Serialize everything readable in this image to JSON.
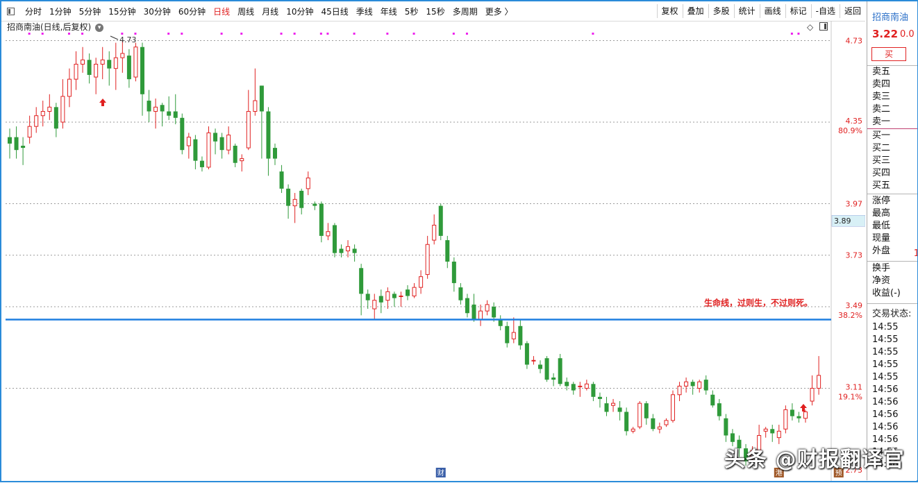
{
  "toolbar": {
    "periods": [
      {
        "label": "分时",
        "active": false
      },
      {
        "label": "1分钟",
        "active": false
      },
      {
        "label": "5分钟",
        "active": false
      },
      {
        "label": "15分钟",
        "active": false
      },
      {
        "label": "30分钟",
        "active": false
      },
      {
        "label": "60分钟",
        "active": false
      },
      {
        "label": "日线",
        "active": true
      },
      {
        "label": "周线",
        "active": false
      },
      {
        "label": "月线",
        "active": false
      },
      {
        "label": "10分钟",
        "active": false
      },
      {
        "label": "45日线",
        "active": false
      },
      {
        "label": "季线",
        "active": false
      },
      {
        "label": "年线",
        "active": false
      },
      {
        "label": "5秒",
        "active": false
      },
      {
        "label": "15秒",
        "active": false
      },
      {
        "label": "多周期",
        "active": false
      },
      {
        "label": "更多 〉",
        "active": false
      }
    ],
    "tools": [
      "复权",
      "叠加",
      "多股",
      "统计",
      "画线",
      "标记",
      "-自选",
      "返回"
    ]
  },
  "chart": {
    "title": "招商南油(日线,后复权)",
    "high_label": "4.73",
    "annotation": "生命线，过则生，不过则死。",
    "price_tag": "3.89",
    "axis_labels": [
      {
        "price": 4.73,
        "text": "4.73",
        "pct": ""
      },
      {
        "price": 4.35,
        "text": "4.35",
        "pct": "80.9%"
      },
      {
        "price": 3.97,
        "text": "3.97",
        "pct": ""
      },
      {
        "price": 3.73,
        "text": "3.73",
        "pct": ""
      },
      {
        "price": 3.49,
        "text": "3.49",
        "pct": "38.2%"
      },
      {
        "price": 3.11,
        "text": "3.11",
        "pct": "19.1%"
      },
      {
        "price": 2.73,
        "text": "2.73",
        "pct": ""
      }
    ],
    "lifeline_price": 3.43,
    "colors": {
      "up": "#e02020",
      "down": "#2f9a3a",
      "lifeline": "#1f7fe0",
      "marker": "#ee22ee",
      "grid": "#9a9a9a"
    },
    "bottom_markers": [
      {
        "label": "财",
        "index": 65
      },
      {
        "label": "港",
        "index": 116
      },
      {
        "label": "预",
        "index": 125
      }
    ]
  },
  "chart_data": {
    "type": "candlestick",
    "ylim": [
      2.73,
      4.78
    ],
    "ohlc": [
      [
        4.28,
        4.25,
        4.18,
        4.32
      ],
      [
        4.28,
        4.22,
        4.18,
        4.33
      ],
      [
        4.24,
        4.23,
        4.15,
        4.28
      ],
      [
        4.28,
        4.33,
        4.25,
        4.38
      ],
      [
        4.33,
        4.38,
        4.3,
        4.42
      ],
      [
        4.38,
        4.4,
        4.33,
        4.45
      ],
      [
        4.4,
        4.42,
        4.36,
        4.48
      ],
      [
        4.42,
        4.32,
        4.28,
        4.44
      ],
      [
        4.35,
        4.47,
        4.32,
        4.55
      ],
      [
        4.47,
        4.55,
        4.42,
        4.6
      ],
      [
        4.55,
        4.62,
        4.5,
        4.68
      ],
      [
        4.62,
        4.64,
        4.58,
        4.7
      ],
      [
        4.64,
        4.57,
        4.53,
        4.67
      ],
      [
        4.56,
        4.62,
        4.48,
        4.65
      ],
      [
        4.62,
        4.64,
        4.55,
        4.7
      ],
      [
        4.64,
        4.6,
        4.52,
        4.68
      ],
      [
        4.6,
        4.65,
        4.5,
        4.72
      ],
      [
        4.65,
        4.67,
        4.58,
        4.73
      ],
      [
        4.66,
        4.55,
        4.51,
        4.69
      ],
      [
        4.56,
        4.7,
        4.54,
        4.72
      ],
      [
        4.7,
        4.48,
        4.38,
        4.72
      ],
      [
        4.45,
        4.4,
        4.35,
        4.5
      ],
      [
        4.4,
        4.42,
        4.32,
        4.46
      ],
      [
        4.43,
        4.4,
        4.33,
        4.44
      ],
      [
        4.4,
        4.38,
        4.36,
        4.47
      ],
      [
        4.4,
        4.37,
        4.34,
        4.48
      ],
      [
        4.37,
        4.22,
        4.2,
        4.39
      ],
      [
        4.24,
        4.28,
        4.18,
        4.3
      ],
      [
        4.27,
        4.17,
        4.13,
        4.29
      ],
      [
        4.17,
        4.14,
        4.12,
        4.19
      ],
      [
        4.14,
        4.3,
        4.13,
        4.33
      ],
      [
        4.3,
        4.26,
        4.2,
        4.32
      ],
      [
        4.28,
        4.22,
        4.18,
        4.3
      ],
      [
        4.22,
        4.29,
        4.2,
        4.33
      ],
      [
        4.24,
        4.16,
        4.14,
        4.25
      ],
      [
        4.17,
        4.18,
        4.12,
        4.2
      ],
      [
        4.23,
        4.4,
        4.22,
        4.5
      ],
      [
        4.4,
        4.45,
        4.38,
        4.6
      ],
      [
        4.52,
        4.4,
        4.18,
        4.52
      ],
      [
        4.4,
        4.18,
        4.1,
        4.42
      ],
      [
        4.23,
        4.18,
        4.15,
        4.25
      ],
      [
        4.12,
        4.04,
        4.02,
        4.15
      ],
      [
        4.04,
        3.96,
        3.9,
        4.06
      ],
      [
        3.96,
        3.99,
        3.88,
        4.02
      ],
      [
        4.03,
        3.95,
        3.92,
        4.04
      ],
      [
        4.04,
        4.09,
        4.01,
        4.12
      ],
      [
        3.97,
        3.96,
        3.94,
        3.98
      ],
      [
        3.97,
        3.82,
        3.79,
        3.98
      ],
      [
        3.82,
        3.84,
        3.8,
        3.88
      ],
      [
        3.87,
        3.74,
        3.72,
        3.88
      ],
      [
        3.76,
        3.74,
        3.72,
        3.78
      ],
      [
        3.75,
        3.77,
        3.72,
        3.8
      ],
      [
        3.76,
        3.74,
        3.7,
        3.78
      ],
      [
        3.67,
        3.55,
        3.45,
        3.69
      ],
      [
        3.55,
        3.52,
        3.48,
        3.57
      ],
      [
        3.48,
        3.52,
        3.43,
        3.55
      ],
      [
        3.54,
        3.51,
        3.46,
        3.57
      ],
      [
        3.52,
        3.56,
        3.48,
        3.58
      ],
      [
        3.55,
        3.53,
        3.49,
        3.56
      ],
      [
        3.54,
        3.54,
        3.49,
        3.56
      ],
      [
        3.57,
        3.54,
        3.52,
        3.59
      ],
      [
        3.54,
        3.58,
        3.53,
        3.6
      ],
      [
        3.58,
        3.63,
        3.55,
        3.66
      ],
      [
        3.64,
        3.78,
        3.62,
        3.82
      ],
      [
        3.8,
        3.87,
        3.78,
        3.92
      ],
      [
        3.96,
        3.82,
        3.8,
        3.97
      ],
      [
        3.8,
        3.7,
        3.67,
        3.82
      ],
      [
        3.7,
        3.6,
        3.56,
        3.72
      ],
      [
        3.58,
        3.52,
        3.5,
        3.6
      ],
      [
        3.53,
        3.46,
        3.44,
        3.55
      ],
      [
        3.5,
        3.43,
        3.42,
        3.55
      ],
      [
        3.43,
        3.47,
        3.4,
        3.5
      ],
      [
        3.47,
        3.5,
        3.45,
        3.52
      ],
      [
        3.49,
        3.44,
        3.42,
        3.51
      ],
      [
        3.43,
        3.4,
        3.38,
        3.45
      ],
      [
        3.4,
        3.32,
        3.3,
        3.42
      ],
      [
        3.34,
        3.37,
        3.32,
        3.44
      ],
      [
        3.4,
        3.31,
        3.29,
        3.43
      ],
      [
        3.32,
        3.22,
        3.2,
        3.33
      ],
      [
        3.24,
        3.24,
        3.22,
        3.26
      ],
      [
        3.22,
        3.2,
        3.18,
        3.24
      ],
      [
        3.25,
        3.15,
        3.14,
        3.26
      ],
      [
        3.16,
        3.15,
        3.12,
        3.18
      ],
      [
        3.25,
        3.13,
        3.12,
        3.27
      ],
      [
        3.14,
        3.12,
        3.1,
        3.16
      ],
      [
        3.13,
        3.1,
        3.08,
        3.14
      ],
      [
        3.12,
        3.12,
        3.07,
        3.14
      ],
      [
        3.11,
        3.13,
        3.1,
        3.15
      ],
      [
        3.13,
        3.07,
        3.05,
        3.14
      ],
      [
        3.07,
        3.06,
        3.02,
        3.09
      ],
      [
        3.04,
        3.0,
        2.98,
        3.07
      ],
      [
        3.03,
        3.04,
        3.0,
        3.06
      ],
      [
        3.02,
        3.0,
        2.96,
        3.05
      ],
      [
        3.0,
        2.91,
        2.89,
        3.02
      ],
      [
        2.91,
        2.92,
        2.9,
        2.93
      ],
      [
        2.93,
        3.04,
        2.92,
        3.05
      ],
      [
        3.04,
        2.97,
        2.94,
        3.05
      ],
      [
        2.97,
        2.92,
        2.91,
        2.99
      ],
      [
        2.92,
        2.93,
        2.9,
        2.95
      ],
      [
        2.94,
        2.96,
        2.93,
        2.97
      ],
      [
        2.96,
        3.08,
        2.95,
        3.1
      ],
      [
        3.08,
        3.12,
        3.05,
        3.14
      ],
      [
        3.12,
        3.14,
        3.09,
        3.16
      ],
      [
        3.14,
        3.12,
        3.08,
        3.15
      ],
      [
        3.11,
        3.14,
        3.09,
        3.15
      ],
      [
        3.15,
        3.1,
        3.08,
        3.17
      ],
      [
        3.08,
        3.03,
        3.02,
        3.1
      ],
      [
        3.04,
        2.98,
        2.96,
        3.06
      ],
      [
        2.97,
        2.89,
        2.86,
        2.99
      ],
      [
        2.9,
        2.86,
        2.84,
        2.92
      ],
      [
        2.87,
        2.83,
        2.79,
        2.89
      ],
      [
        2.83,
        2.77,
        2.75,
        2.85
      ],
      [
        2.79,
        2.82,
        2.77,
        2.84
      ],
      [
        2.82,
        2.89,
        2.8,
        2.94
      ],
      [
        2.91,
        2.92,
        2.88,
        2.93
      ],
      [
        2.92,
        2.9,
        2.86,
        2.94
      ],
      [
        2.88,
        2.91,
        2.85,
        2.94
      ],
      [
        2.92,
        3.01,
        2.9,
        3.03
      ],
      [
        3.01,
        2.98,
        2.96,
        3.04
      ],
      [
        2.98,
        2.97,
        2.95,
        3.0
      ],
      [
        2.97,
        3.0,
        2.95,
        3.01
      ],
      [
        3.05,
        3.11,
        3.03,
        3.17
      ],
      [
        3.11,
        3.17,
        3.08,
        3.26
      ]
    ]
  },
  "right_panel": {
    "name": "招商南油",
    "price": "3.22",
    "change": "0.0",
    "buy_label": "买",
    "sell_levels": [
      "卖五",
      "卖四",
      "卖三",
      "卖二",
      "卖一"
    ],
    "buy_levels": [
      "买一",
      "买二",
      "买三",
      "买四",
      "买五"
    ],
    "stats1": [
      "涨停",
      "最高",
      "最低",
      "现量",
      "外盘"
    ],
    "stats1_extra": "1",
    "stats2": [
      "换手",
      "净资",
      "收益(-)"
    ],
    "trade_status": "交易状态:",
    "times": [
      "14:55",
      "14:55",
      "14:55",
      "14:55",
      "14:55",
      "14:56",
      "14:56",
      "14:56",
      "14:56",
      "14:56",
      "14:56",
      "14:56"
    ]
  },
  "watermark": {
    "text": "头条 @财报翻译官"
  }
}
